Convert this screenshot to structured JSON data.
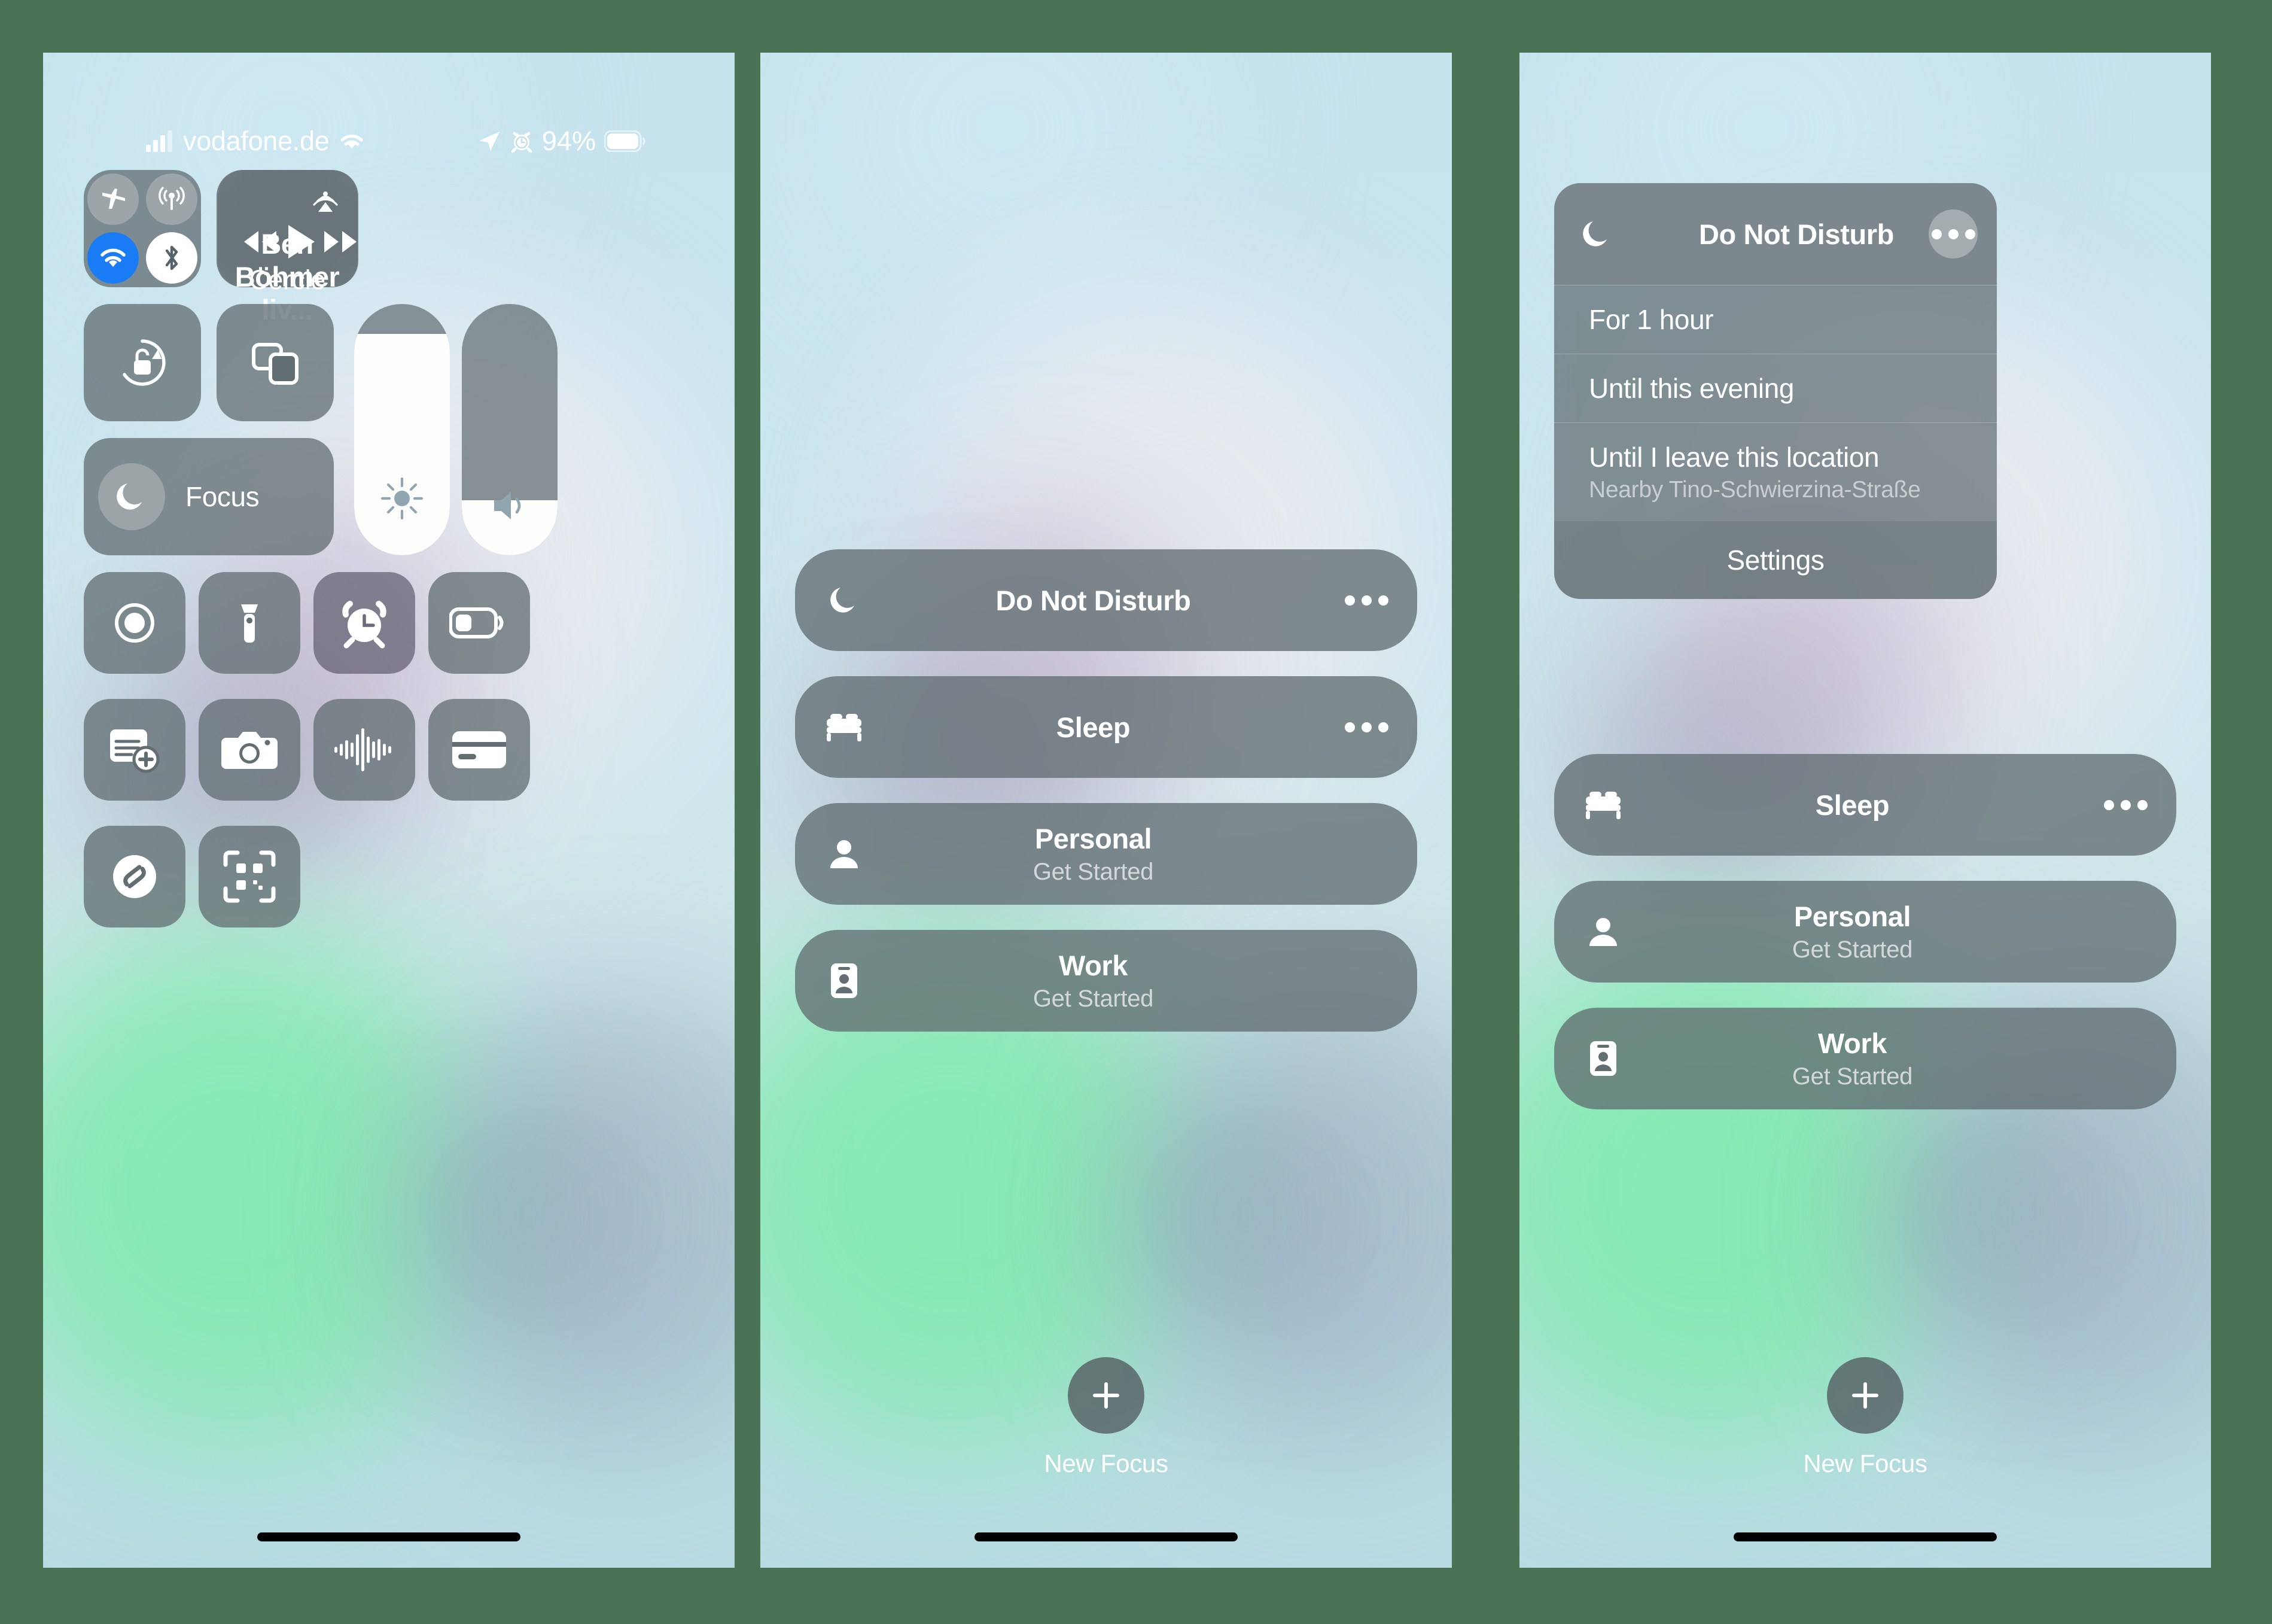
{
  "background_color": "#4a7355",
  "panel_background": "#c7e4ee",
  "accent_colors": {
    "wifi_on_blue": "#1a7cf5",
    "bluetooth_on_white": "#ffffff",
    "toggle_off_grey": "#a0a6aa",
    "card_grey": "#636e72"
  },
  "status_bar": {
    "signal_icon": "cellular-bars-icon",
    "carrier": "vodafone.de",
    "wifi_icon": "wifi-icon",
    "location_icon": "location-arrow-icon",
    "alarm_icon": "alarm-clock-icon",
    "battery_percent": "94%",
    "battery_icon": "battery-icon"
  },
  "panel1": {
    "name": "control-center",
    "connectivity": {
      "airplane": {
        "icon": "airplane-icon",
        "state": "off"
      },
      "cellular": {
        "icon": "cellular-antenna-icon",
        "state": "off"
      },
      "wifi": {
        "icon": "wifi-icon",
        "state": "on"
      },
      "bluetooth": {
        "icon": "bluetooth-icon",
        "state": "on"
      }
    },
    "media": {
      "airplay_icon": "airplay-audio-icon",
      "title": "Ben Böhmer liv...",
      "artist": "Cercle",
      "rewind_icon": "rewind-icon",
      "play_icon": "play-icon",
      "forward_icon": "fast-forward-icon"
    },
    "tiles": {
      "rotation_lock": "rotation-lock-icon",
      "screen_mirroring": "screen-mirroring-icon",
      "screen_record": "screen-record-icon",
      "flashlight": "flashlight-icon",
      "timer": "alarm-clock-icon",
      "low_power": "battery-low-power-icon",
      "notes": "notes-add-icon",
      "camera": "camera-icon",
      "voice_memos": "voice-memo-waveform-icon",
      "wallet": "wallet-icon",
      "shazam": "shazam-icon",
      "qr_scanner": "qr-code-scanner-icon"
    },
    "sliders": {
      "brightness": {
        "icon": "brightness-sun-icon",
        "value": 88
      },
      "volume": {
        "icon": "speaker-volume-icon",
        "value": 22
      }
    },
    "focus_tile": {
      "icon": "crescent-moon-icon",
      "label": "Focus"
    }
  },
  "panel2": {
    "name": "focus-picker",
    "modes": [
      {
        "icon": "crescent-moon-icon",
        "name": "Do Not Disturb",
        "subtitle": "",
        "has_more": true,
        "active": true
      },
      {
        "icon": "bed-icon",
        "name": "Sleep",
        "subtitle": "",
        "has_more": true,
        "active": false
      },
      {
        "icon": "person-icon",
        "name": "Personal",
        "subtitle": "Get Started",
        "has_more": false,
        "active": false
      },
      {
        "icon": "id-badge-icon",
        "name": "Work",
        "subtitle": "Get Started",
        "has_more": false,
        "active": false
      }
    ],
    "new_focus": {
      "icon": "plus-icon",
      "label": "New Focus"
    }
  },
  "panel3": {
    "name": "focus-picker-with-dnd-menu",
    "dnd_menu": {
      "icon": "crescent-moon-icon",
      "title": "Do Not Disturb",
      "more_icon": "ellipsis-icon",
      "options": [
        {
          "label": "For 1 hour",
          "sublabel": ""
        },
        {
          "label": "Until this evening",
          "sublabel": ""
        },
        {
          "label": "Until I leave this location",
          "sublabel": "Nearby Tino-Schwierzina-Straße"
        }
      ],
      "settings_label": "Settings"
    },
    "modes": [
      {
        "icon": "bed-icon",
        "name": "Sleep",
        "subtitle": "",
        "has_more": true
      },
      {
        "icon": "person-icon",
        "name": "Personal",
        "subtitle": "Get Started",
        "has_more": false
      },
      {
        "icon": "id-badge-icon",
        "name": "Work",
        "subtitle": "Get Started",
        "has_more": false
      }
    ],
    "new_focus": {
      "icon": "plus-icon",
      "label": "New Focus"
    }
  }
}
